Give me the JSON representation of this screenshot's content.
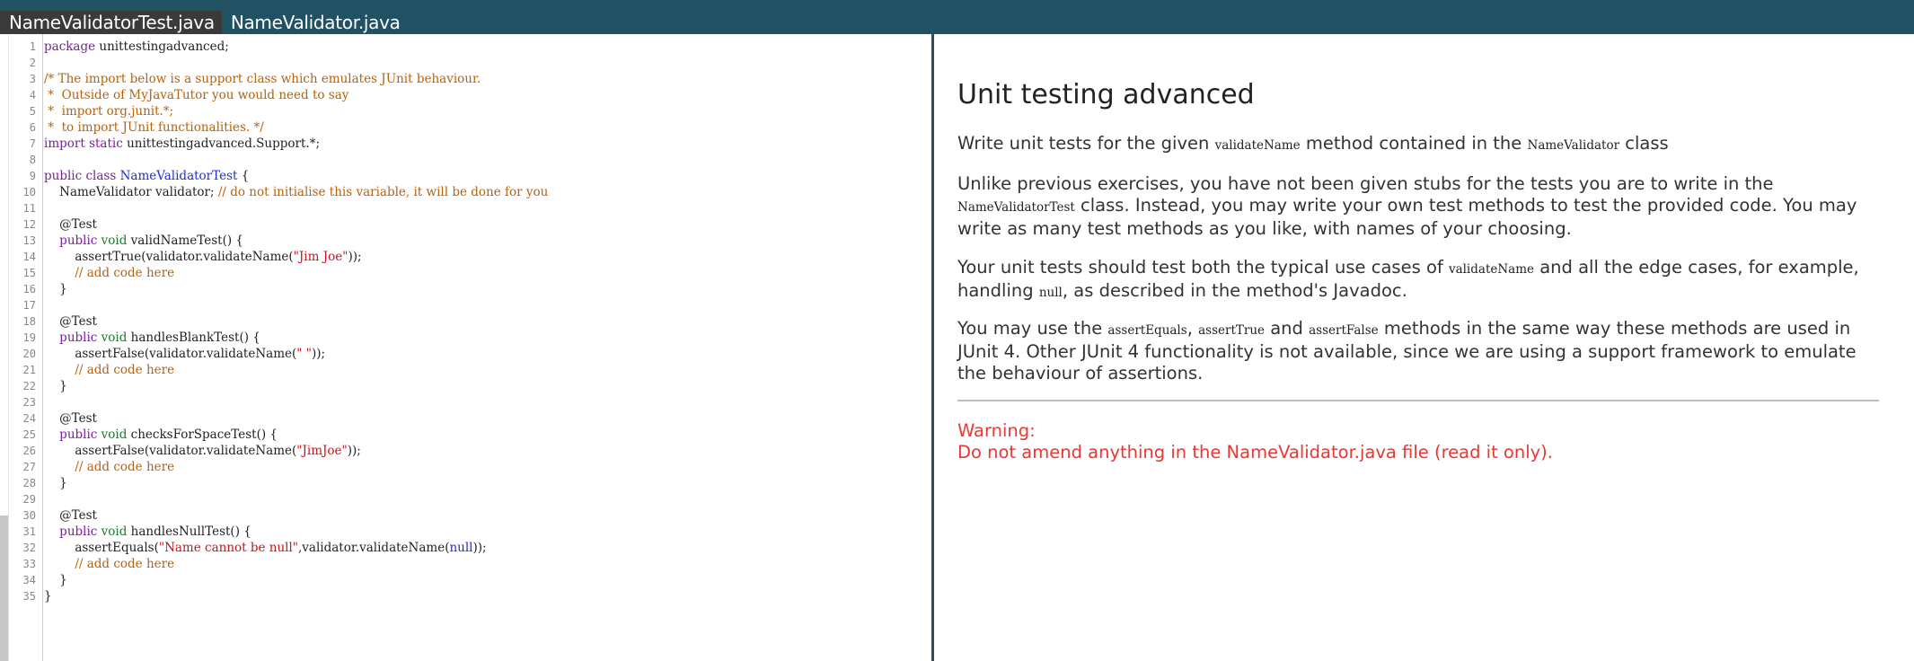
{
  "tabs": [
    {
      "label": "NameValidatorTest.java"
    },
    {
      "label": "NameValidator.java"
    }
  ],
  "code": [
    "package unittestingadvanced;",
    "",
    "/* The import below is a support class which emulates JUnit behaviour.",
    " *  Outside of MyJavaTutor you would need to say",
    " *  import org.junit.*;",
    " *  to import JUnit functionalities. */",
    "import static unittestingadvanced.Support.*;",
    "",
    "public class NameValidatorTest {",
    "    NameValidator validator; // do not initialise this variable, it will be done for you",
    "",
    "    @Test",
    "    public void validNameTest() {",
    "        assertTrue(validator.validateName(\"Jim Joe\"));",
    "        // add code here",
    "    }",
    "",
    "    @Test",
    "    public void handlesBlankTest() {",
    "        assertFalse(validator.validateName(\" \"));",
    "        // add code here",
    "    }",
    "",
    "    @Test",
    "    public void checksForSpaceTest() {",
    "        assertFalse(validator.validateName(\"JimJoe\"));",
    "        // add code here",
    "    }",
    "",
    "    @Test",
    "    public void handlesNullTest() {",
    "        assertEquals(\"Name cannot be null\",validator.validateName(null));",
    "        // add code here",
    "    }",
    "}"
  ],
  "instructions": {
    "title": "Unit testing advanced",
    "p1": {
      "a": "Write unit tests for the given ",
      "code1": "validateName",
      "b": " method contained in the ",
      "code2": "NameValidator",
      "c": " class"
    },
    "p2": {
      "a": "Unlike previous exercises, you have not been given stubs for the tests you are to write in the ",
      "code1": "NameValidatorTest",
      "b": " class. Instead, you may write your own test methods to test the provided code. You may write as many test methods as you like, with names of your choosing."
    },
    "p3": {
      "a": "Your unit tests should test both the typical use cases of ",
      "code1": "validateName",
      "b": " and all the edge cases, for example, handling ",
      "code2": "null",
      "c": ", as described in the method's Javadoc."
    },
    "p4": {
      "a": "You may use the ",
      "code1": "assertEquals",
      "sep1": ", ",
      "code2": "assertTrue",
      "b": " and ",
      "code3": "assertFalse",
      "c": " methods in the same way these methods are used in JUnit 4. Other JUnit 4 functionality is not available, since we are using a support framework to emulate the behaviour of assertions."
    },
    "warning_label": "Warning:",
    "warning_text": "Do not amend anything in the NameValidator.java file (read it only)."
  },
  "colors": {
    "tabbar": "#215264",
    "active_tab": "#3a3a3a",
    "keyword": "#7a1e9c",
    "type": "#1c7a2b",
    "class_name": "#1d2fd6",
    "comment": "#b5620d",
    "string": "#c4141b",
    "warning": "#e53935"
  }
}
